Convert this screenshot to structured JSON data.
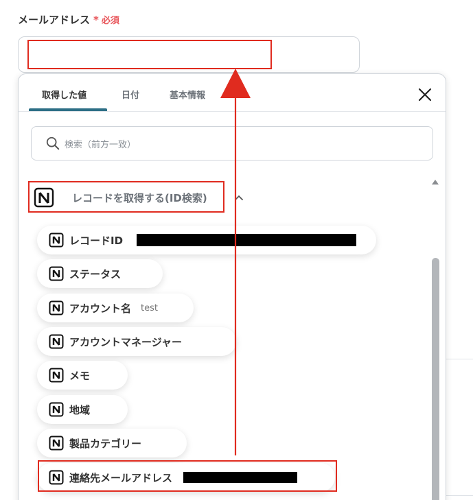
{
  "field": {
    "label": "メールアドレス",
    "required_mark": "*",
    "required_text": "必須"
  },
  "tabs": [
    {
      "label": "取得した値"
    },
    {
      "label": "日付"
    },
    {
      "label": "基本情報"
    }
  ],
  "search": {
    "placeholder": "検索（前方一致）"
  },
  "group": {
    "title": "レコードを取得する(ID検索)"
  },
  "items": [
    {
      "label": "レコードID",
      "value": ""
    },
    {
      "label": "ステータス",
      "value": ""
    },
    {
      "label": "アカウント名",
      "value": "test"
    },
    {
      "label": "アカウントマネージャー",
      "value": ""
    },
    {
      "label": "メモ",
      "value": ""
    },
    {
      "label": "地域",
      "value": ""
    },
    {
      "label": "製品カテゴリー",
      "value": ""
    },
    {
      "label": "連絡先メールアドレス",
      "value": ""
    }
  ],
  "icons": {
    "item_icon": "notion-icon",
    "search": "search-icon",
    "close": "close-icon",
    "collapse": "chevron-up-icon"
  },
  "colors": {
    "highlight": "#e02b1f",
    "required": "#e8565b",
    "tab_active": "#2d6f86"
  }
}
